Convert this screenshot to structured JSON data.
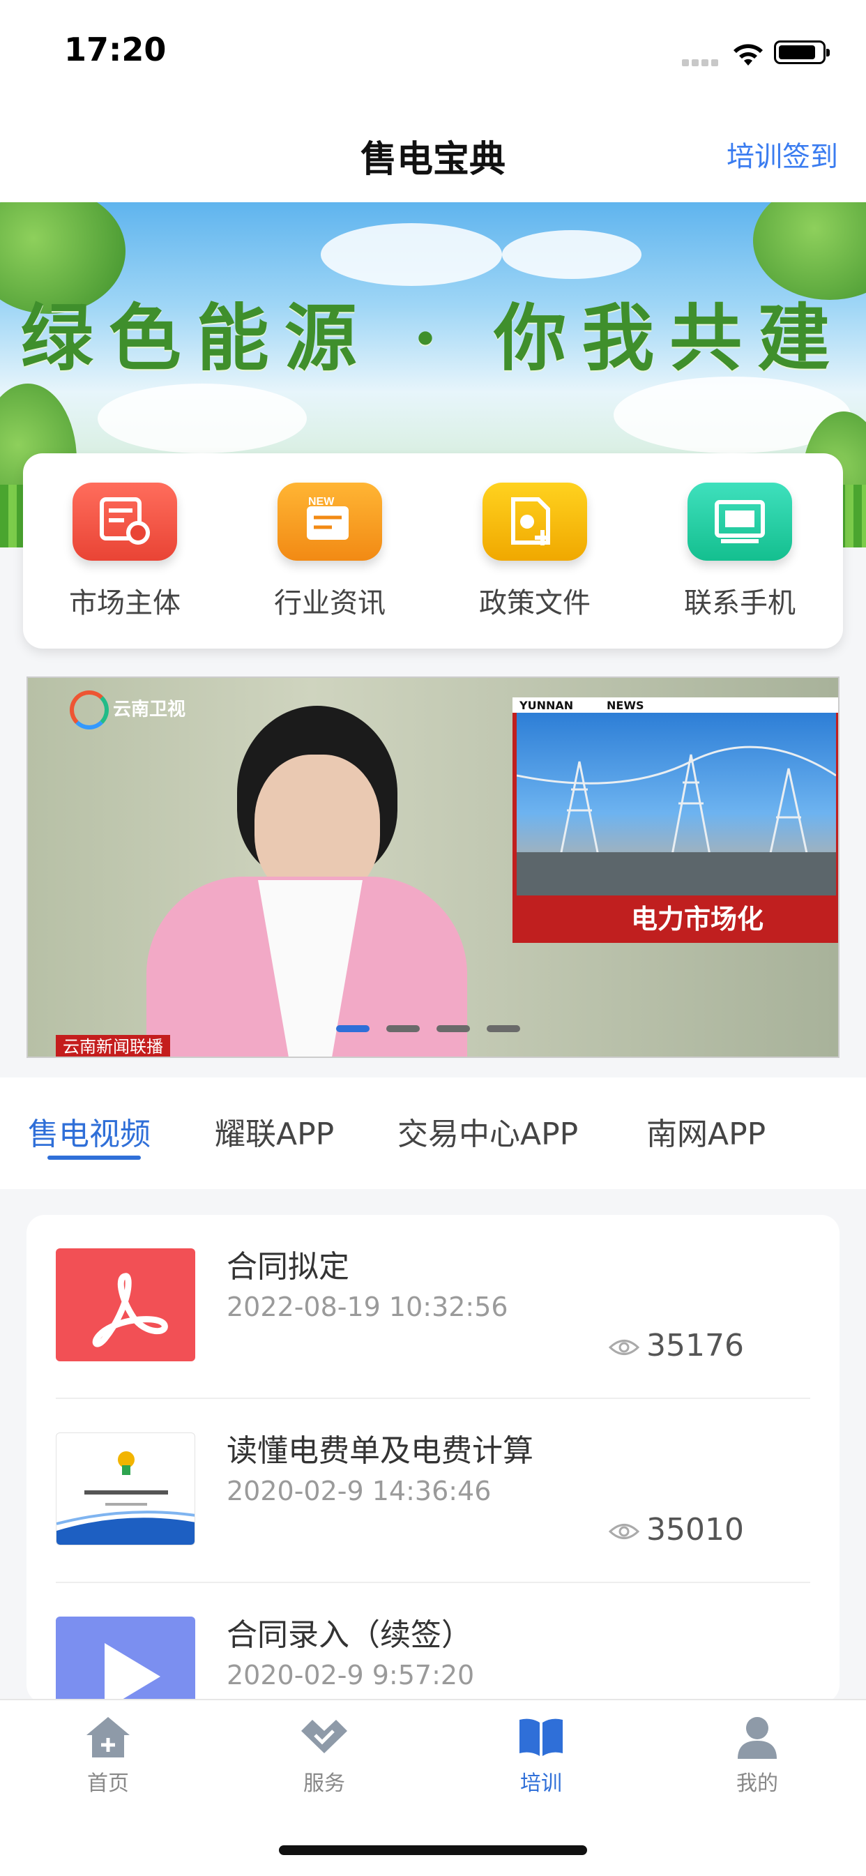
{
  "status_bar": {
    "time": "17:20"
  },
  "nav": {
    "title": "售电宝典",
    "action": "培训签到"
  },
  "banner": {
    "slogan": "绿色能源 · 你我共建"
  },
  "quick_entries": [
    {
      "label": "市场主体",
      "icon": "market-entity-icon",
      "color": "#f05a4a"
    },
    {
      "label": "行业资讯",
      "icon": "news-icon",
      "color": "#f59a1f"
    },
    {
      "label": "政策文件",
      "icon": "policy-file-icon",
      "color": "#f2b400"
    },
    {
      "label": "联系手机",
      "icon": "contact-phone-icon",
      "color": "#27d0a4"
    }
  ],
  "video": {
    "channel_logo": "云南卫视",
    "inset_header_left": "YUNNAN",
    "inset_header_right": "NEWS",
    "inset_caption": "电力市场化",
    "program_tag": "云南新闻联播",
    "carousel_pages": 4,
    "carousel_active": 1
  },
  "tabs": [
    {
      "label": "售电视频",
      "active": true
    },
    {
      "label": "耀联APP",
      "active": false
    },
    {
      "label": "交易中心APP",
      "active": false
    },
    {
      "label": "南网APP",
      "active": false
    }
  ],
  "list": [
    {
      "title": "合同拟定",
      "date": "2022-08-19 10:32:56",
      "views": "35176",
      "thumb": "pdf-icon"
    },
    {
      "title": "读懂电费单及电费计算",
      "date": "2020-02-9 14:36:46",
      "views": "35010",
      "thumb": "slide-thumbnail"
    },
    {
      "title": "合同录入（续签）",
      "date": "2020-02-9 9:57:20",
      "views": "",
      "thumb": "play-icon"
    }
  ],
  "tab_bar": [
    {
      "label": "首页",
      "icon": "home-icon",
      "active": false
    },
    {
      "label": "服务",
      "icon": "handshake-icon",
      "active": false
    },
    {
      "label": "培训",
      "icon": "book-icon",
      "active": true
    },
    {
      "label": "我的",
      "icon": "profile-icon",
      "active": false
    }
  ],
  "colors": {
    "accent": "#2f6fd8",
    "link": "#3a7cf0"
  }
}
